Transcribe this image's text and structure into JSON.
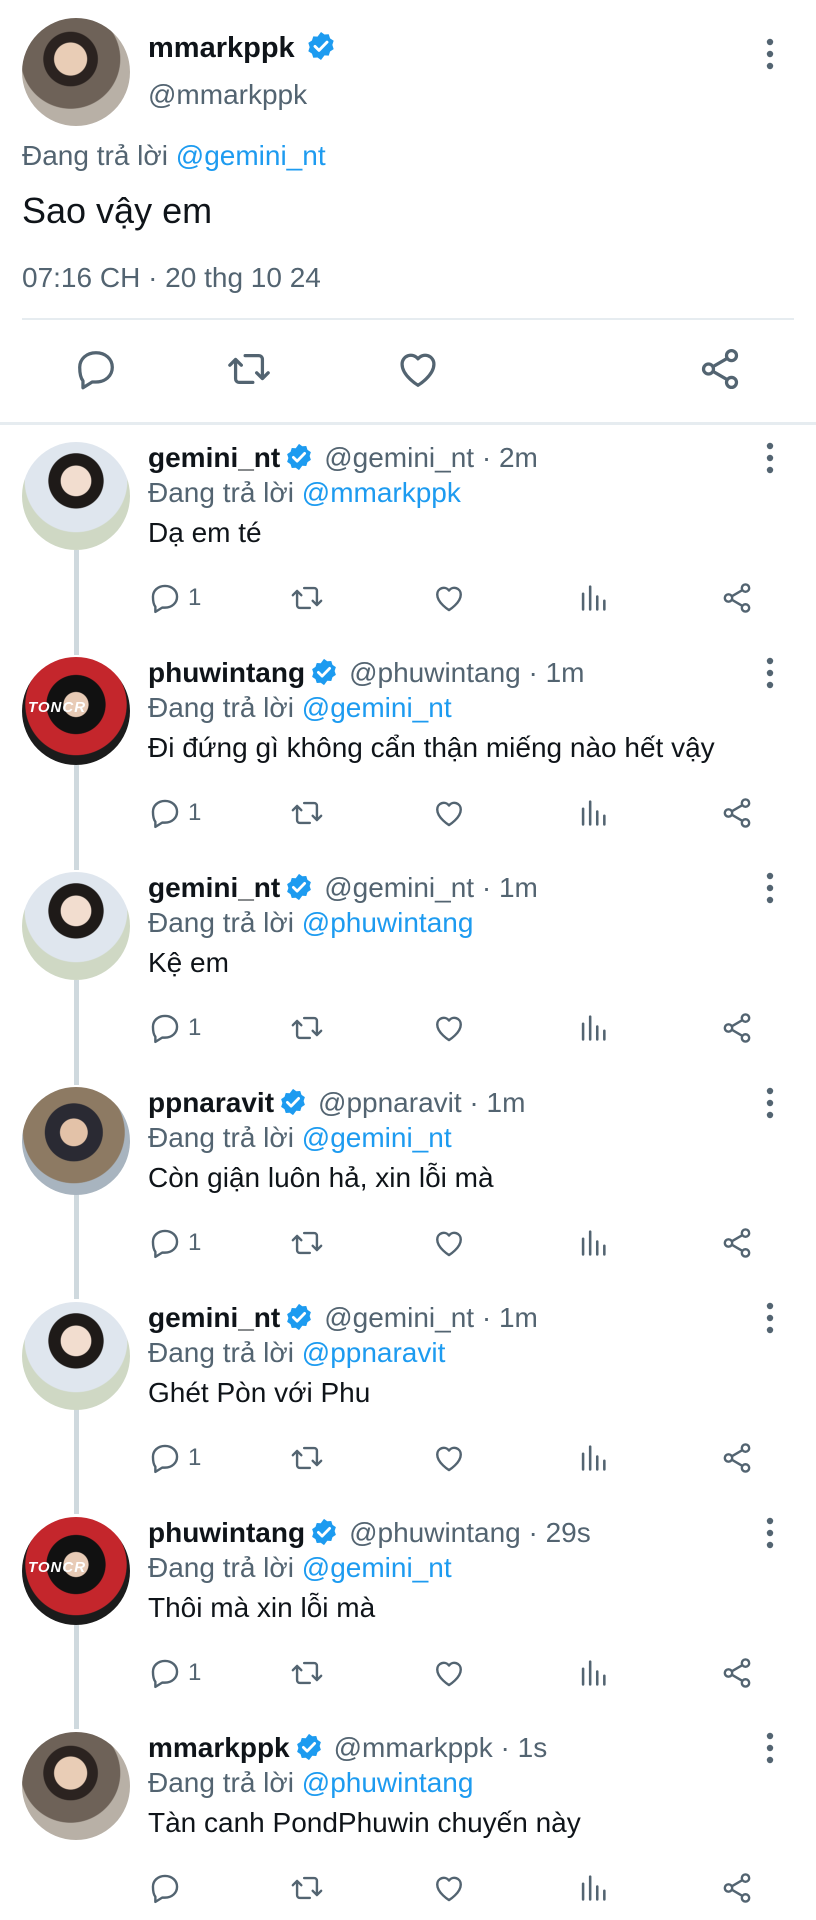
{
  "main_tweet": {
    "display_name": "mmarkppk",
    "handle": "@mmarkppk",
    "replying_prefix": "Đang trả lời",
    "replying_to": "@gemini_nt",
    "text": "Sao vậy em",
    "timestamp": "07:16 CH · 20 thg 10 24"
  },
  "replies": [
    {
      "name": "gemini_nt",
      "handle": "@gemini_nt · 2m",
      "replying_prefix": "Đang trả lời",
      "replying_to": "@mmarkppk",
      "text": "Dạ em té",
      "reply_count": "1"
    },
    {
      "name": "phuwintang",
      "handle": "@phuwintang · 1m",
      "replying_prefix": "Đang trả lời",
      "replying_to": "@gemini_nt",
      "text": "Đi đứng gì không cẩn thận miếng nào hết vậy",
      "reply_count": "1",
      "avatar_text": "TONCR"
    },
    {
      "name": "gemini_nt",
      "handle": "@gemini_nt · 1m",
      "replying_prefix": "Đang trả lời",
      "replying_to": "@phuwintang",
      "text": "Kệ em",
      "reply_count": "1"
    },
    {
      "name": "ppnaravit",
      "handle": "@ppnaravit · 1m",
      "replying_prefix": "Đang trả lời",
      "replying_to": "@gemini_nt",
      "text": "Còn giận luôn hả, xin lỗi mà",
      "reply_count": "1"
    },
    {
      "name": "gemini_nt",
      "handle": "@gemini_nt · 1m",
      "replying_prefix": "Đang trả lời",
      "replying_to": "@ppnaravit",
      "text": "Ghét Pòn với Phu",
      "reply_count": "1"
    },
    {
      "name": "phuwintang",
      "handle": "@phuwintang · 29s",
      "replying_prefix": "Đang trả lời",
      "replying_to": "@gemini_nt",
      "text": "Thôi mà xin lỗi mà",
      "reply_count": "1",
      "avatar_text": "TONCR"
    },
    {
      "name": "mmarkppk",
      "handle": "@mmarkppk · 1s",
      "replying_prefix": "Đang trả lời",
      "replying_to": "@phuwintang",
      "text": "Tàn canh PondPhuwin chuyến này",
      "reply_count": ""
    }
  ],
  "colors": {
    "accent": "#1d9bf0",
    "muted": "#536471",
    "text": "#0f1419",
    "divider": "#e6ecf0"
  },
  "icons": [
    "verified-badge-icon",
    "more-vertical-icon",
    "reply-icon",
    "retweet-icon",
    "like-icon",
    "views-icon",
    "share-icon"
  ]
}
